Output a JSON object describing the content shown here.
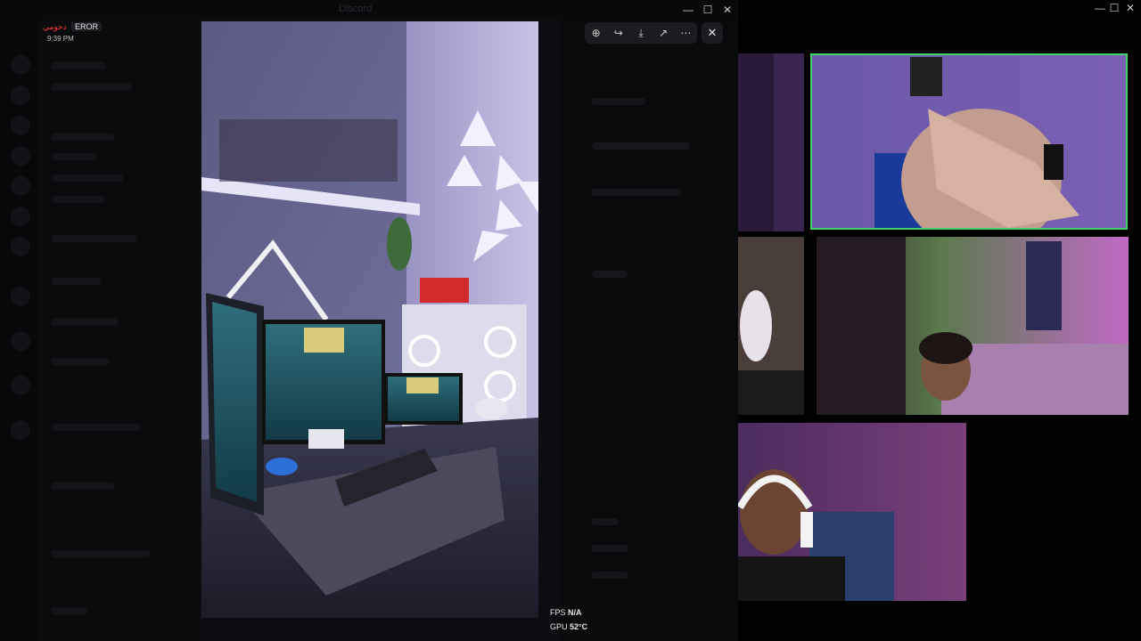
{
  "discord": {
    "title": "Discord",
    "overlay": {
      "user": "دحومي",
      "tag": "EROR",
      "time": "9:39 PM"
    }
  },
  "viewer": {
    "toolbar": [
      {
        "name": "zoom-in-icon",
        "glyph": "⊕"
      },
      {
        "name": "share-forward-icon",
        "glyph": "↪"
      },
      {
        "name": "download-icon",
        "glyph": "⤓"
      },
      {
        "name": "open-external-icon",
        "glyph": "↗"
      },
      {
        "name": "more-options-icon",
        "glyph": "⋯"
      }
    ],
    "close_glyph": "✕"
  },
  "stats": {
    "fps_label": "FPS",
    "fps_value": "N/A",
    "gpu_label": "GPU",
    "gpu_value": "52°C"
  },
  "window_controls": {
    "minimize": "—",
    "maximize": "☐",
    "close": "✕"
  }
}
